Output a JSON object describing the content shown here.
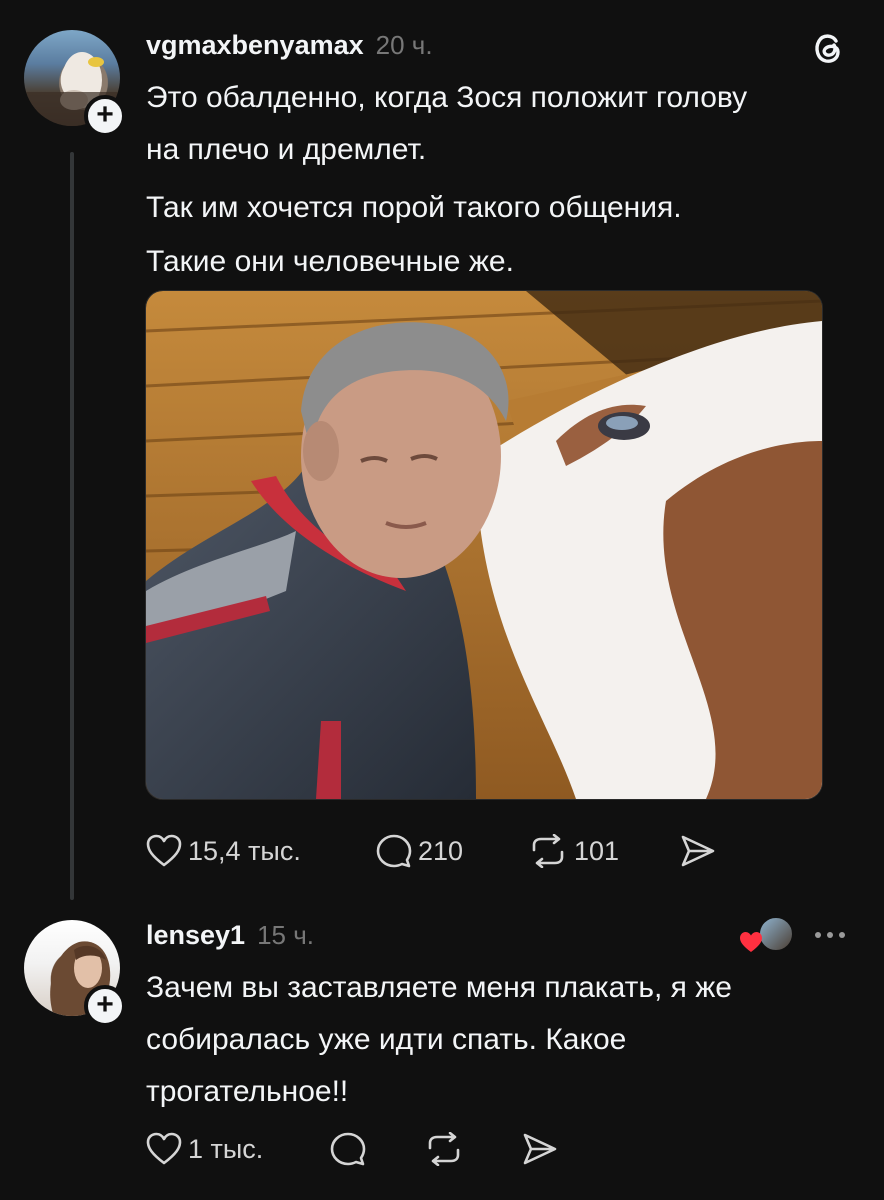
{
  "post": {
    "username": "vgmaxbenyamax",
    "time": "20 ч.",
    "paragraphs": [
      "Это обалденно, когда Зося положит голову",
      "на плечо и дремлет.",
      "Так им хочется порой такого общения.",
      "Такие они человечные же."
    ],
    "likes": "15,4 тыс.",
    "comments": "210",
    "reposts": "101"
  },
  "reply": {
    "username": "lensey1",
    "time": "15 ч.",
    "lines": [
      "Зачем вы заставляете меня плакать, я же",
      "собиралась уже идти спать. Какое",
      "трогательное!!"
    ],
    "likes": "1 тыс."
  },
  "icons": {
    "app": "threads-logo-icon",
    "like": "heart-icon",
    "comment": "comment-bubble-icon",
    "repost": "repost-icon",
    "share": "send-icon",
    "more": "more-icon",
    "liked_by_author": "liked-by-author-avatar"
  },
  "colors": {
    "background": "#101010",
    "text": "#f3f5f7",
    "muted": "#777777",
    "heart": "#ff3040"
  }
}
